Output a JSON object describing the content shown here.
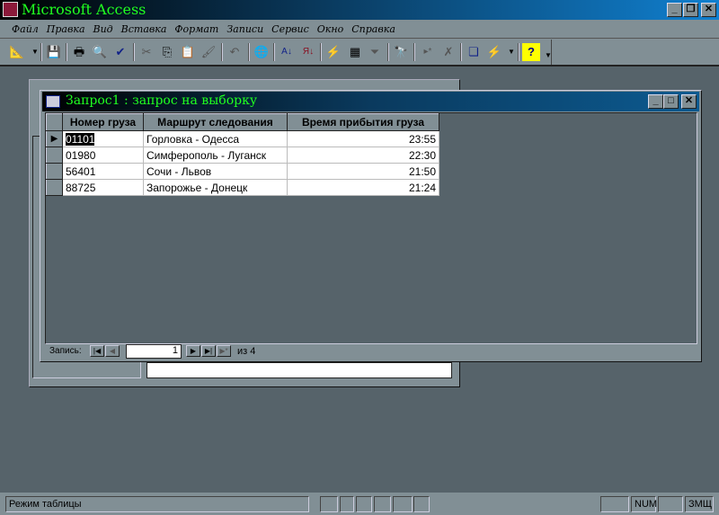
{
  "app": {
    "title": "Microsoft Access"
  },
  "menu": [
    "Файл",
    "Правка",
    "Вид",
    "Вставка",
    "Формат",
    "Записи",
    "Сервис",
    "Окно",
    "Справка"
  ],
  "window": {
    "title": "Запрос1 : запрос на выборку",
    "columns": [
      "Номер груза",
      "Маршрут следования",
      "Время прибытия груза"
    ],
    "rows": [
      [
        "01101",
        "Горловка - Одесса",
        "23:55"
      ],
      [
        "01980",
        "Симферополь - Луганск",
        "22:30"
      ],
      [
        "56401",
        "Сочи - Львов",
        "21:50"
      ],
      [
        "88725",
        "Запорожье - Донецк",
        "21:24"
      ]
    ]
  },
  "nav": {
    "label": "Запись:",
    "current": "1",
    "total": "из 4"
  },
  "status": {
    "mode": "Режим таблицы",
    "num": "NUM",
    "caps": "ЗМЩ"
  }
}
